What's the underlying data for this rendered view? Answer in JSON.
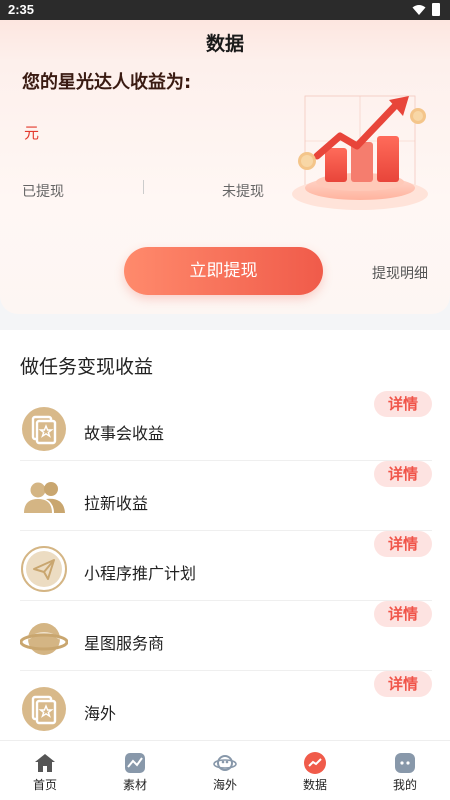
{
  "status_bar": {
    "time": "2:35"
  },
  "header": {
    "title": "数据"
  },
  "earnings": {
    "title": "您的星光达人收益为:",
    "unit": "元",
    "withdrawn_label": "已提现",
    "unwithdrawn_label": "未提现",
    "withdraw_button": "立即提现",
    "withdraw_detail": "提现明细"
  },
  "tasks": {
    "title": "做任务变现收益",
    "items": [
      {
        "label": "故事会收益",
        "icon": "story-card-icon",
        "action": "详情"
      },
      {
        "label": "拉新收益",
        "icon": "users-icon",
        "action": "详情"
      },
      {
        "label": "小程序推广计划",
        "icon": "paper-plane-icon",
        "action": "详情"
      },
      {
        "label": "星图服务商",
        "icon": "planet-icon",
        "action": "详情"
      },
      {
        "label": "海外",
        "icon": "story-card-icon",
        "action": "详情"
      }
    ]
  },
  "tabbar": {
    "items": [
      {
        "label": "首页",
        "icon": "home-icon"
      },
      {
        "label": "素材",
        "icon": "material-icon"
      },
      {
        "label": "海外",
        "icon": "overseas-icon"
      },
      {
        "label": "数据",
        "icon": "data-icon",
        "active": true
      },
      {
        "label": "我的",
        "icon": "profile-icon"
      }
    ]
  },
  "colors": {
    "accent": "#f05b4a",
    "task_icon": "#d4b584",
    "detail_bg": "#fde3e1"
  }
}
